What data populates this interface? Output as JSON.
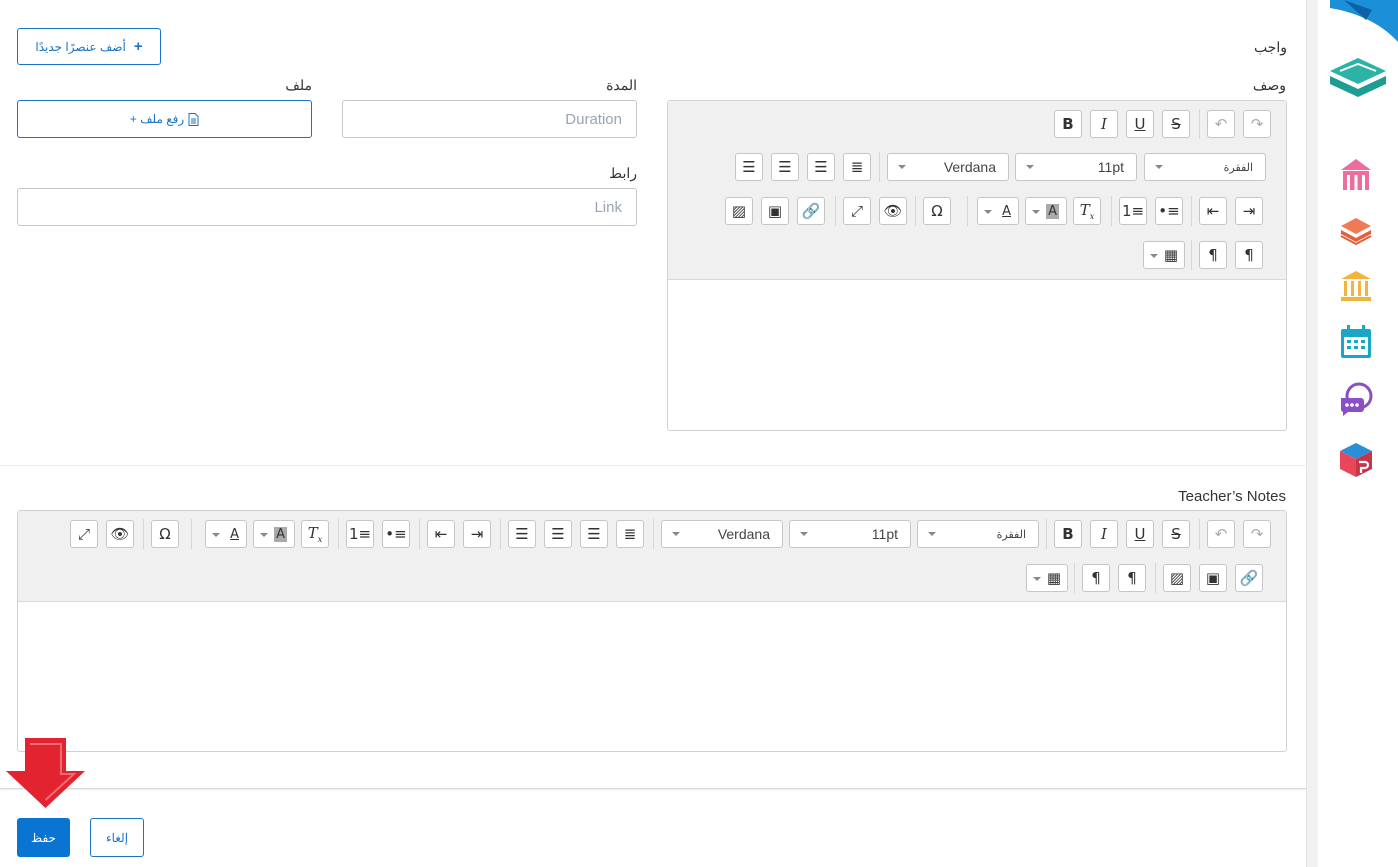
{
  "header": {
    "add_item_label": "أضف عنصرًا جديدًا",
    "assignment_label": "واجب"
  },
  "form": {
    "description_label": "وصف",
    "duration_label": "المدة",
    "duration_placeholder": "Duration",
    "file_label": "ملف",
    "upload_label": "+ رفع ملف",
    "link_label": "رابط",
    "link_placeholder": "Link"
  },
  "editor": {
    "paragraph_select": "الفقرة",
    "font_size_select": "11pt",
    "font_family_select": "Verdana"
  },
  "notes": {
    "label": "Teacher’s Notes"
  },
  "footer": {
    "save_label": "حفظ",
    "cancel_label": "إلغاء"
  },
  "colors": {
    "accent": "#0a74d3",
    "arrow": "#e3232f"
  },
  "sidebar": {
    "icons": [
      "brand-logo-icon",
      "school-icon",
      "books-icon",
      "institution-icon",
      "calendar-icon",
      "chat-icon",
      "cube-icon"
    ]
  }
}
